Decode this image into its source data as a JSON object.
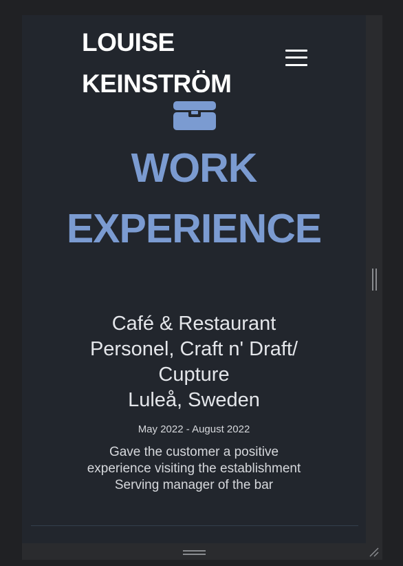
{
  "header": {
    "brand_line1": "LOUISE",
    "brand_line2": "KEINSTRÖM",
    "menu_icon": "hamburger-menu-icon"
  },
  "section": {
    "icon": "briefcase-icon",
    "title_line1": "WORK",
    "title_line2": "EXPERIENCE"
  },
  "job": {
    "title_lines": [
      "Café & Restaurant",
      "Personel, Craft n' Draft/",
      "Cupture"
    ],
    "location": "Luleå, Sweden",
    "dates": "May 2022 - August 2022",
    "description_lines": [
      "Gave the customer a positive",
      "experience visiting the establishment",
      "Serving manager of the bar"
    ]
  },
  "colors": {
    "page_background": "#22262d",
    "accent": "#7b9bd1",
    "text": "#e4e6ea",
    "outer_background": "#202124"
  }
}
